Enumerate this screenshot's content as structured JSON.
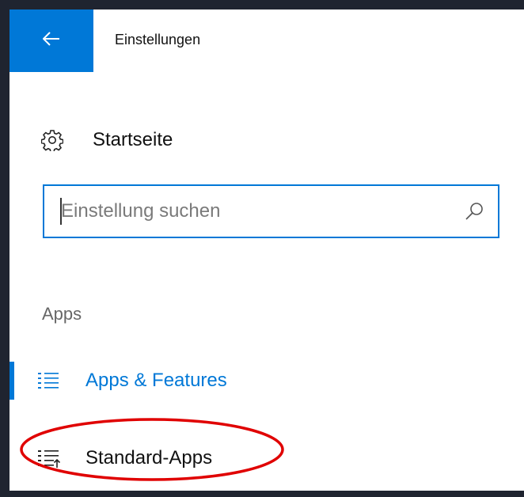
{
  "window": {
    "title": "Einstellungen"
  },
  "nav": {
    "home": {
      "label": "Startseite",
      "icon": "gear-icon"
    },
    "back_icon": "arrow-left-icon"
  },
  "search": {
    "value": "",
    "placeholder": "Einstellung suchen",
    "icon": "search-icon"
  },
  "section": {
    "header": "Apps",
    "items": [
      {
        "label": "Apps & Features",
        "icon": "list-icon",
        "active": true
      },
      {
        "label": "Standard-Apps",
        "icon": "list-default-icon",
        "active": false
      }
    ]
  },
  "colors": {
    "accent": "#0078d7",
    "frame": "#1f2430",
    "annotation": "#e00000"
  }
}
